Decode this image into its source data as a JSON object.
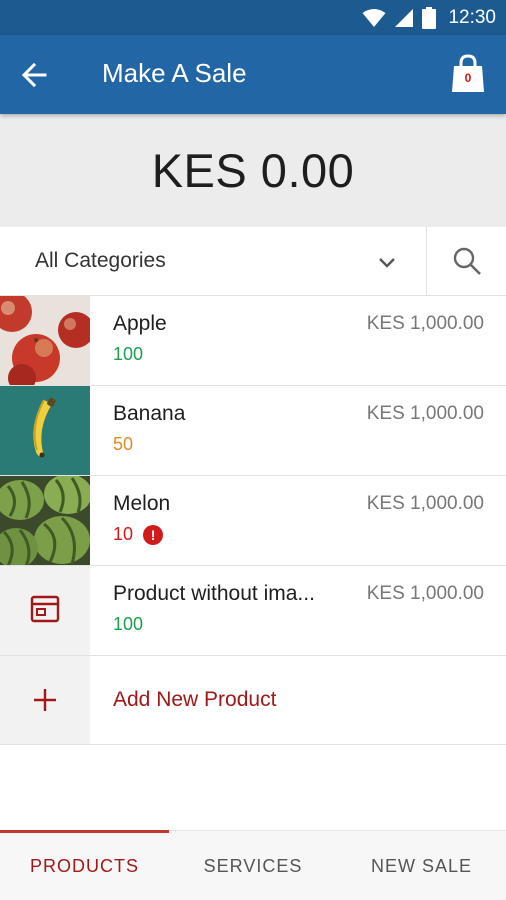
{
  "status_bar": {
    "time": "12:30"
  },
  "app_bar": {
    "title": "Make A Sale",
    "cart_count": "0"
  },
  "sale": {
    "amount": "KES 0.00"
  },
  "filter": {
    "category": "All Categories"
  },
  "products": [
    {
      "name": "Apple",
      "price": "KES 1,000.00",
      "stock": "100",
      "stock_level": "green",
      "image": "apples"
    },
    {
      "name": "Banana",
      "price": "KES 1,000.00",
      "stock": "50",
      "stock_level": "orange",
      "image": "banana"
    },
    {
      "name": "Melon",
      "price": "KES 1,000.00",
      "stock": "10",
      "stock_level": "red",
      "low_stock_warning": "!",
      "image": "melons"
    },
    {
      "name": "Product without image",
      "display_name": "Product without ima...",
      "price": "KES 1,000.00",
      "stock": "100",
      "stock_level": "green",
      "image": "box-icon"
    }
  ],
  "add_product": {
    "label": "Add New Product"
  },
  "tabs": [
    {
      "label": "PRODUCTS",
      "active": true
    },
    {
      "label": "SERVICES",
      "active": false
    },
    {
      "label": "NEW SALE",
      "active": false
    }
  ],
  "colors": {
    "app_bar": "#2266a6",
    "status_bar": "#1c5a8f",
    "accent": "#a01818",
    "stock_green": "#1aa04f",
    "stock_orange": "#e58a1f",
    "stock_red": "#d11a1a"
  }
}
